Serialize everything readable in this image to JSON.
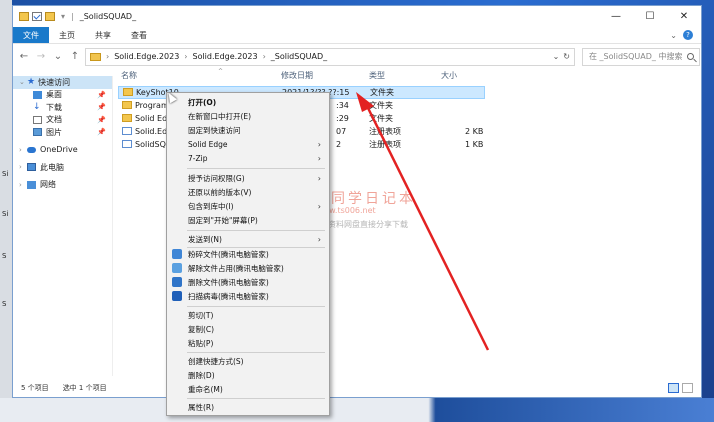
{
  "desktop": {
    "labels": [
      "Si",
      "Si",
      "S",
      "S"
    ]
  },
  "window": {
    "title": "_SolidSQUAD_",
    "controls": {
      "minimize": "—",
      "maximize": "☐",
      "close": "✕"
    }
  },
  "ribbon": {
    "tabs": [
      "文件",
      "主页",
      "共享",
      "查看"
    ]
  },
  "address": {
    "back": "←",
    "forward": "→",
    "up": "↑",
    "crumbs": [
      "Solid.Edge.2023",
      "Solid.Edge.2023",
      "_SolidSQUAD_"
    ],
    "search_placeholder": "在 _SolidSQUAD_ 中搜索"
  },
  "nav": {
    "items": [
      {
        "label": "快速访问",
        "pin": ""
      },
      {
        "label": "桌面",
        "pin": "📌"
      },
      {
        "label": "下载",
        "pin": "📌"
      },
      {
        "label": "文档",
        "pin": "📌"
      },
      {
        "label": "图片",
        "pin": "📌"
      },
      {
        "label": "OneDrive",
        "pin": ""
      },
      {
        "label": "此电脑",
        "pin": ""
      },
      {
        "label": "网络",
        "pin": ""
      }
    ]
  },
  "columns": {
    "name": "名称",
    "date": "修改日期",
    "type": "类型",
    "size": "大小"
  },
  "files": [
    {
      "name": "KeyShot10",
      "date": "2021/1?/?? ??:15",
      "type": "文件夹",
      "size": ""
    },
    {
      "name": "Programl",
      "date": ":34",
      "type": "文件夹",
      "size": ""
    },
    {
      "name": "Solid Edg",
      "date": ":29",
      "type": "文件夹",
      "size": ""
    },
    {
      "name": "Solid.Edg",
      "date": "07",
      "type": "注册表项",
      "size": "2 KB"
    },
    {
      "name": "SolidSQU",
      "date": "2",
      "type": "注册表项",
      "size": "1 KB"
    }
  ],
  "status": {
    "count": "5 个项目",
    "selected": "选中 1 个项目"
  },
  "context_menu": {
    "items": [
      {
        "label": "打开(O)",
        "bold": true
      },
      {
        "label": "在新窗口中打开(E)"
      },
      {
        "label": "固定到快速访问"
      },
      {
        "label": "Solid Edge",
        "submenu": true
      },
      {
        "label": "7-Zip",
        "submenu": true
      },
      {
        "label": "授予访问权限(G)",
        "submenu": true
      },
      {
        "label": "还原以前的版本(V)"
      },
      {
        "label": "包含到库中(I)",
        "submenu": true
      },
      {
        "label": "固定到\"开始\"屏幕(P)"
      },
      {
        "label": "发送到(N)",
        "submenu": true
      },
      {
        "label": "粉碎文件(腾讯电脑管家)"
      },
      {
        "label": "解除文件占用(腾讯电脑管家)"
      },
      {
        "label": "删除文件(腾讯电脑管家)"
      },
      {
        "label": "扫描病毒(腾讯电脑管家)"
      },
      {
        "label": "剪切(T)"
      },
      {
        "label": "复制(C)"
      },
      {
        "label": "粘贴(P)"
      },
      {
        "label": "创建快捷方式(S)"
      },
      {
        "label": "删除(D)"
      },
      {
        "label": "重命名(M)"
      },
      {
        "label": "属性(R)"
      }
    ],
    "submenu_arrow": "›"
  },
  "watermark": {
    "title": "下同学日记本",
    "url": "www.ts006.net",
    "sub": "软件、资源、资料网盘直接分享下载"
  },
  "colors": {
    "accent": "#1979ca",
    "selection": "#cce8ff",
    "arrow": "#e32222"
  }
}
